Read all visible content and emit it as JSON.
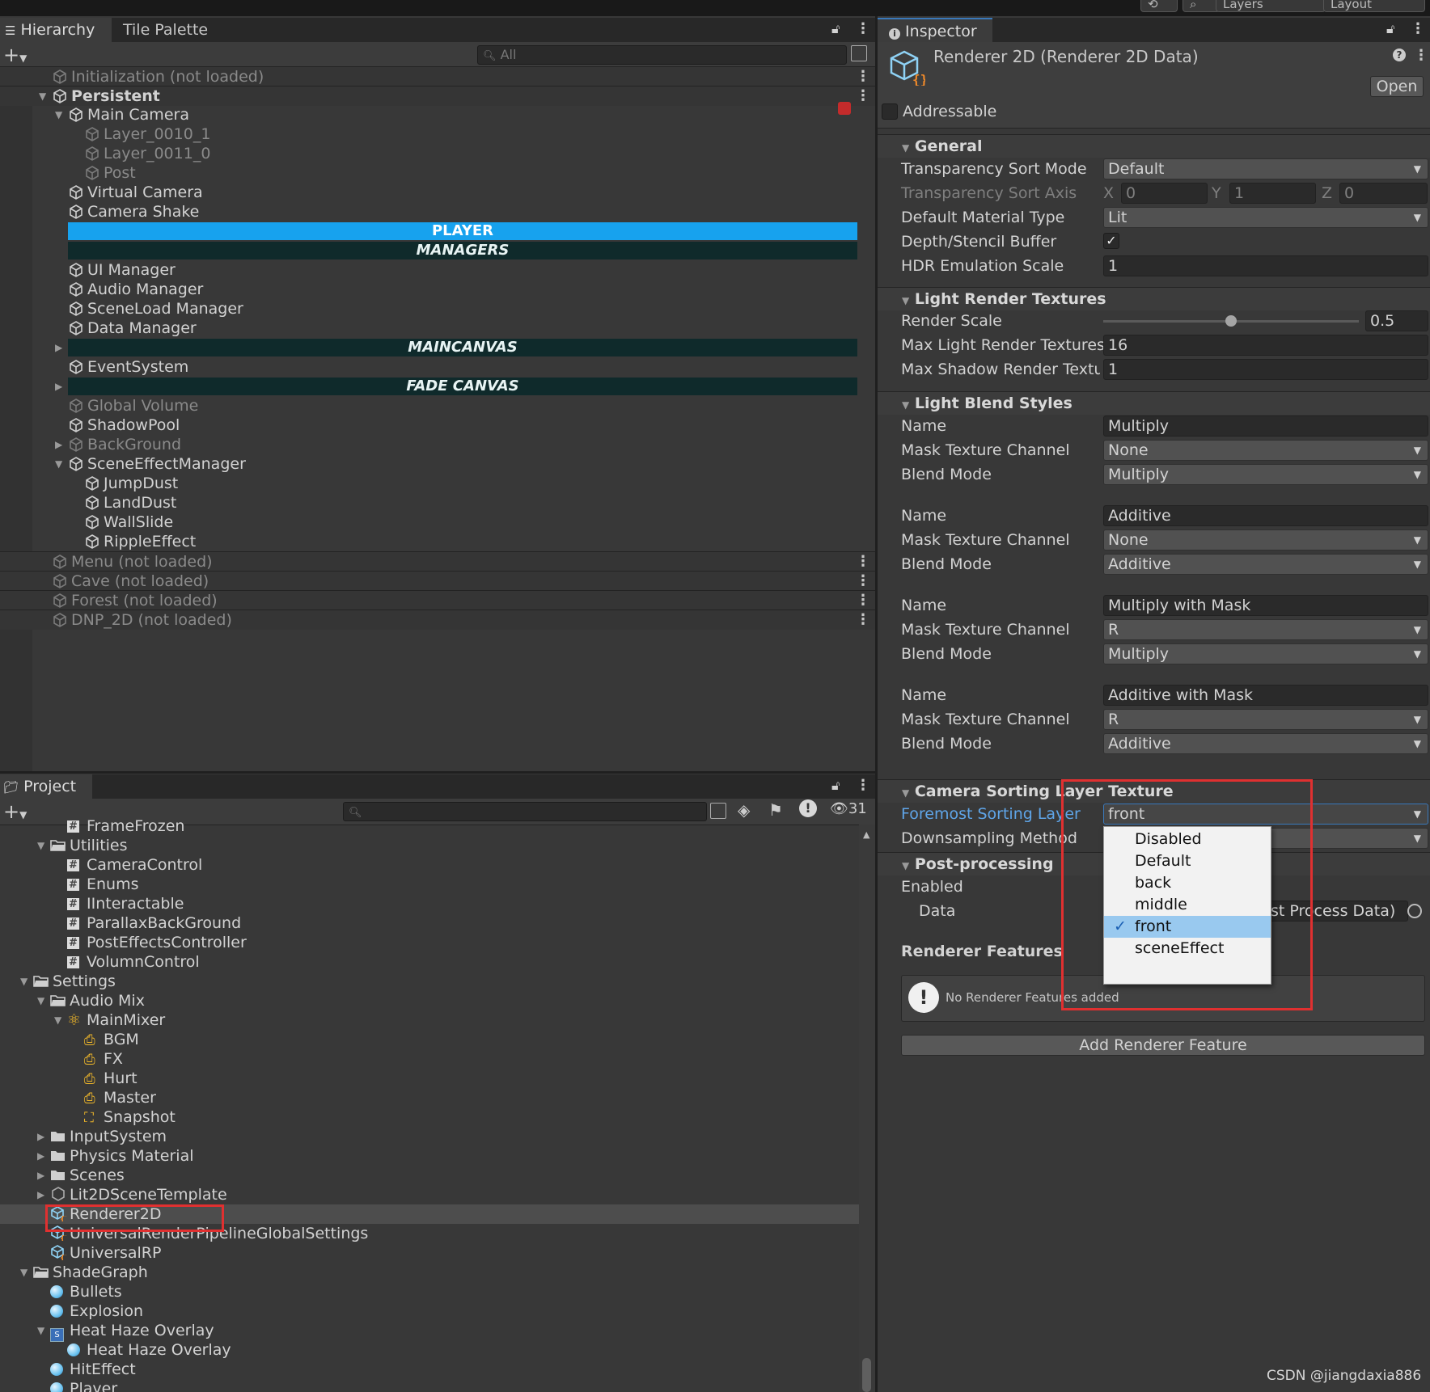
{
  "top_bar": {
    "layers_label": "Layers",
    "layout_label": "Layout"
  },
  "hierarchy": {
    "tabs": [
      "Hierarchy",
      "Tile Palette"
    ],
    "search_placeholder": "All",
    "rows": [
      {
        "label": "Initialization (not loaded)",
        "depth": 0,
        "kind": "scene",
        "dim": true
      },
      {
        "label": "Persistent",
        "depth": 0,
        "kind": "scene",
        "bold": true,
        "expanded": true
      },
      {
        "label": "Main Camera",
        "depth": 1,
        "expanded": true
      },
      {
        "label": "Layer_0010_1",
        "depth": 2,
        "dim": true
      },
      {
        "label": "Layer_0011_0",
        "depth": 2,
        "dim": true
      },
      {
        "label": "Post",
        "depth": 2,
        "dim": true
      },
      {
        "label": "Virtual Camera",
        "depth": 1
      },
      {
        "label": "Camera Shake",
        "depth": 1
      },
      {
        "label": "PLAYER",
        "kind": "banner",
        "style": "player"
      },
      {
        "label": "MANAGERS",
        "kind": "banner",
        "style": "dark"
      },
      {
        "label": "UI Manager",
        "depth": 1
      },
      {
        "label": "Audio Manager",
        "depth": 1
      },
      {
        "label": "SceneLoad Manager",
        "depth": 1
      },
      {
        "label": "Data Manager",
        "depth": 1
      },
      {
        "label": "MAINCANVAS",
        "kind": "banner",
        "style": "dark",
        "collapsed": true
      },
      {
        "label": "EventSystem",
        "depth": 1
      },
      {
        "label": "FADE CANVAS",
        "kind": "banner",
        "style": "dark",
        "collapsed": true
      },
      {
        "label": "Global Volume",
        "depth": 1,
        "dim": true
      },
      {
        "label": "ShadowPool",
        "depth": 1
      },
      {
        "label": "BackGround",
        "depth": 1,
        "dim": true,
        "collapsed": true
      },
      {
        "label": "SceneEffectManager",
        "depth": 1,
        "expanded": true
      },
      {
        "label": "JumpDust",
        "depth": 2
      },
      {
        "label": "LandDust",
        "depth": 2
      },
      {
        "label": "WallSlide",
        "depth": 2
      },
      {
        "label": "RippleEffect",
        "depth": 2
      },
      {
        "label": "Menu (not loaded)",
        "depth": 0,
        "kind": "scene",
        "dim": true
      },
      {
        "label": "Cave (not loaded)",
        "depth": 0,
        "kind": "scene",
        "dim": true
      },
      {
        "label": "Forest (not loaded)",
        "depth": 0,
        "kind": "scene",
        "dim": true
      },
      {
        "label": "DNP_2D (not loaded)",
        "depth": 0,
        "kind": "scene",
        "dim": true
      }
    ]
  },
  "project": {
    "tab": "Project",
    "hidden_count": "31",
    "rows": [
      {
        "label": "FrameFrozen",
        "depth": 3,
        "icon": "script"
      },
      {
        "label": "Utilities",
        "depth": 2,
        "icon": "folder-open",
        "expanded": true
      },
      {
        "label": "CameraControl",
        "depth": 3,
        "icon": "script"
      },
      {
        "label": "Enums",
        "depth": 3,
        "icon": "script"
      },
      {
        "label": "IInteractable",
        "depth": 3,
        "icon": "script"
      },
      {
        "label": "ParallaxBackGround",
        "depth": 3,
        "icon": "script"
      },
      {
        "label": "PostEffectsController",
        "depth": 3,
        "icon": "script"
      },
      {
        "label": "VolumnControl",
        "depth": 3,
        "icon": "script"
      },
      {
        "label": "Settings",
        "depth": 1,
        "icon": "folder-open",
        "expanded": true
      },
      {
        "label": "Audio Mix",
        "depth": 2,
        "icon": "folder-open",
        "expanded": true
      },
      {
        "label": "MainMixer",
        "depth": 3,
        "icon": "mixer",
        "expanded": true
      },
      {
        "label": "BGM",
        "depth": 4,
        "icon": "group"
      },
      {
        "label": "FX",
        "depth": 4,
        "icon": "group"
      },
      {
        "label": "Hurt",
        "depth": 4,
        "icon": "group"
      },
      {
        "label": "Master",
        "depth": 4,
        "icon": "group"
      },
      {
        "label": "Snapshot",
        "depth": 4,
        "icon": "snapshot"
      },
      {
        "label": "InputSystem",
        "depth": 2,
        "icon": "folder",
        "collapsed": true
      },
      {
        "label": "Physics Material",
        "depth": 2,
        "icon": "folder",
        "collapsed": true
      },
      {
        "label": "Scenes",
        "depth": 2,
        "icon": "folder",
        "collapsed": true
      },
      {
        "label": "Lit2DSceneTemplate",
        "depth": 2,
        "icon": "template",
        "collapsed": true
      },
      {
        "label": "Renderer2D",
        "depth": 2,
        "icon": "renderer",
        "selected": true
      },
      {
        "label": "UniversalRenderPipelineGlobalSettings",
        "depth": 2,
        "icon": "renderer"
      },
      {
        "label": "UniversalRP",
        "depth": 2,
        "icon": "renderer"
      },
      {
        "label": "ShadeGraph",
        "depth": 1,
        "icon": "folder-open",
        "expanded": true
      },
      {
        "label": "Bullets",
        "depth": 2,
        "icon": "shader"
      },
      {
        "label": "Explosion",
        "depth": 2,
        "icon": "shader"
      },
      {
        "label": "Heat Haze Overlay",
        "depth": 2,
        "icon": "subgraph",
        "expanded": true
      },
      {
        "label": "Heat Haze Overlay",
        "depth": 3,
        "icon": "shader"
      },
      {
        "label": "HitEffect",
        "depth": 2,
        "icon": "shader"
      },
      {
        "label": "Player",
        "depth": 2,
        "icon": "shader"
      }
    ]
  },
  "inspector": {
    "tab": "Inspector",
    "title": "Renderer 2D (Renderer 2D Data)",
    "open_button": "Open",
    "addressable_label": "Addressable",
    "general": {
      "header": "General",
      "transparency_sort_mode": {
        "label": "Transparency Sort Mode",
        "value": "Default"
      },
      "transparency_sort_axis": {
        "label": "Transparency Sort Axis",
        "x": "0",
        "y": "1",
        "z": "0"
      },
      "default_material_type": {
        "label": "Default Material Type",
        "value": "Lit"
      },
      "depth_stencil": {
        "label": "Depth/Stencil Buffer",
        "checked": true
      },
      "hdr_scale": {
        "label": "HDR Emulation Scale",
        "value": "1"
      }
    },
    "light_render_textures": {
      "header": "Light Render Textures",
      "render_scale": {
        "label": "Render Scale",
        "value": "0.5",
        "fraction": 0.5
      },
      "max_light": {
        "label": "Max Light Render Textures",
        "value": "16"
      },
      "max_shadow": {
        "label": "Max Shadow Render Textures",
        "value": "1"
      }
    },
    "light_blend_styles": {
      "header": "Light Blend Styles",
      "name_label": "Name",
      "mask_label": "Mask Texture Channel",
      "blend_label": "Blend Mode",
      "styles": [
        {
          "name": "Multiply",
          "mask": "None",
          "blend": "Multiply"
        },
        {
          "name": "Additive",
          "mask": "None",
          "blend": "Additive"
        },
        {
          "name": "Multiply with Mask",
          "mask": "R",
          "blend": "Multiply"
        },
        {
          "name": "Additive with Mask",
          "mask": "R",
          "blend": "Additive"
        }
      ]
    },
    "camera_sorting": {
      "header": "Camera Sorting Layer Texture",
      "foremost_label": "Foremost Sorting Layer",
      "foremost_value": "front",
      "downsampling_label": "Downsampling Method"
    },
    "post_processing": {
      "header": "Post-processing",
      "enabled_label": "Enabled",
      "data_label": "Data",
      "data_value": "st Process Data)"
    },
    "renderer_features": {
      "header": "Renderer Features",
      "empty_message": "No Renderer Features added",
      "add_button": "Add Renderer Feature"
    },
    "popup": {
      "items": [
        "Disabled",
        "Default",
        "back",
        "middle",
        "front",
        "sceneEffect"
      ],
      "selected": "front"
    }
  },
  "watermark": "CSDN @jiangdaxia886",
  "colors": {
    "accent": "#17a2ee",
    "selection": "#99c9ef",
    "highlight_box": "#e03030",
    "banner_dark": "#0f2a2b"
  }
}
